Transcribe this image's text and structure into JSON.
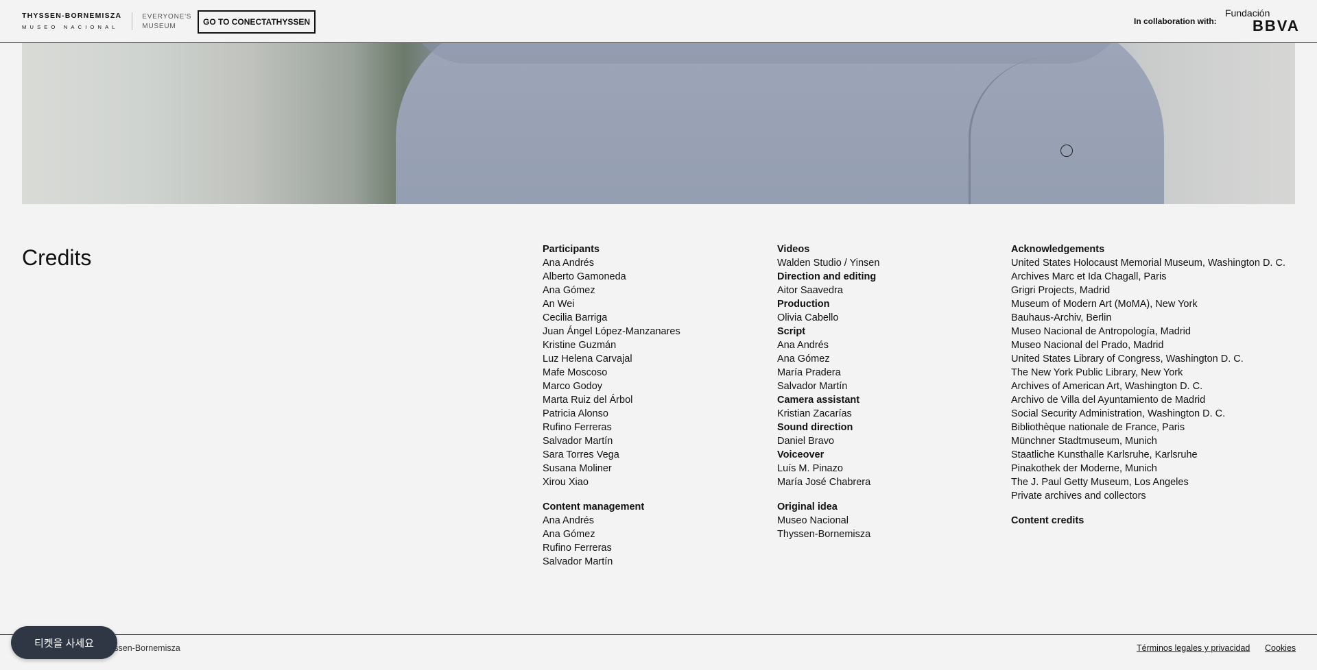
{
  "header": {
    "logo_main": "THYSSEN-BORNEMISZA",
    "logo_sub": "MUSEO NACIONAL",
    "logo_tag_line1": "EVERYONE'S",
    "logo_tag_line2": "MUSEUM",
    "conecta_button": "GO TO CONECTATHYSSEN",
    "collab_label": "In collaboration with:",
    "sponsor_line1": "Fundación",
    "sponsor_line2": "BBVA"
  },
  "credits": {
    "title": "Credits",
    "col1": [
      {
        "type": "h",
        "text": "Participants"
      },
      {
        "type": "t",
        "text": "Ana Andrés"
      },
      {
        "type": "t",
        "text": "Alberto Gamoneda"
      },
      {
        "type": "t",
        "text": "Ana Gómez"
      },
      {
        "type": "t",
        "text": "An Wei"
      },
      {
        "type": "t",
        "text": "Cecilia Barriga"
      },
      {
        "type": "t",
        "text": "Juan Ángel López-Manzanares"
      },
      {
        "type": "t",
        "text": "Kristine Guzmán"
      },
      {
        "type": "t",
        "text": "Luz Helena Carvajal"
      },
      {
        "type": "t",
        "text": "Mafe Moscoso"
      },
      {
        "type": "t",
        "text": "Marco Godoy"
      },
      {
        "type": "t",
        "text": "Marta Ruiz del Árbol"
      },
      {
        "type": "t",
        "text": "Patricia Alonso"
      },
      {
        "type": "t",
        "text": "Rufino Ferreras"
      },
      {
        "type": "t",
        "text": "Salvador Martín"
      },
      {
        "type": "t",
        "text": "Sara Torres Vega"
      },
      {
        "type": "t",
        "text": "Susana Moliner"
      },
      {
        "type": "t",
        "text": "Xirou Xiao"
      },
      {
        "type": "gap",
        "text": ""
      },
      {
        "type": "h",
        "text": "Content management"
      },
      {
        "type": "t",
        "text": "Ana Andrés"
      },
      {
        "type": "t",
        "text": "Ana Gómez"
      },
      {
        "type": "t",
        "text": "Rufino Ferreras"
      },
      {
        "type": "t",
        "text": "Salvador Martín"
      }
    ],
    "col2": [
      {
        "type": "h",
        "text": "Videos"
      },
      {
        "type": "t",
        "text": "Walden Studio / Yinsen"
      },
      {
        "type": "h",
        "text": "Direction and editing"
      },
      {
        "type": "t",
        "text": "Aitor Saavedra"
      },
      {
        "type": "h",
        "text": "Production"
      },
      {
        "type": "t",
        "text": "Olivia Cabello"
      },
      {
        "type": "h",
        "text": "Script"
      },
      {
        "type": "t",
        "text": "Ana Andrés"
      },
      {
        "type": "t",
        "text": "Ana Gómez"
      },
      {
        "type": "t",
        "text": "María Pradera"
      },
      {
        "type": "t",
        "text": "Salvador Martín"
      },
      {
        "type": "h",
        "text": "Camera assistant"
      },
      {
        "type": "t",
        "text": "Kristian Zacarías"
      },
      {
        "type": "h",
        "text": "Sound direction"
      },
      {
        "type": "t",
        "text": "Daniel Bravo"
      },
      {
        "type": "h",
        "text": "Voiceover"
      },
      {
        "type": "t",
        "text": "Luís M. Pinazo"
      },
      {
        "type": "t",
        "text": "María José Chabrera"
      },
      {
        "type": "gap",
        "text": ""
      },
      {
        "type": "h",
        "text": "Original idea"
      },
      {
        "type": "t",
        "text": "Museo Nacional"
      },
      {
        "type": "t",
        "text": "Thyssen-Bornemisza"
      }
    ],
    "col3": [
      {
        "type": "h",
        "text": "Acknowledgements"
      },
      {
        "type": "t",
        "text": "United States Holocaust Memorial Museum, Washington D. C."
      },
      {
        "type": "t",
        "text": "Archives Marc et Ida Chagall, Paris"
      },
      {
        "type": "t",
        "text": "Grigri Projects, Madrid"
      },
      {
        "type": "t",
        "text": "Museum of Modern Art (MoMA), New York"
      },
      {
        "type": "t",
        "text": "Bauhaus-Archiv, Berlin"
      },
      {
        "type": "t",
        "text": "Museo Nacional de Antropología, Madrid"
      },
      {
        "type": "t",
        "text": "Museo Nacional del Prado, Madrid"
      },
      {
        "type": "t",
        "text": "United States Library of Congress, Washington D. C."
      },
      {
        "type": "t",
        "text": "The New York Public Library, New York"
      },
      {
        "type": "t",
        "text": "Archives of American Art, Washington D. C."
      },
      {
        "type": "t",
        "text": "Archivo de Villa del Ayuntamiento de Madrid"
      },
      {
        "type": "t",
        "text": "Social Security Administration, Washington D. C."
      },
      {
        "type": "t",
        "text": "Bibliothèque nationale de France, Paris"
      },
      {
        "type": "t",
        "text": "Münchner Stadtmuseum, Munich"
      },
      {
        "type": "t",
        "text": "Staatliche Kunsthalle Karlsruhe, Karlsruhe"
      },
      {
        "type": "t",
        "text": "Pinakothek der Moderne, Munich"
      },
      {
        "type": "t",
        "text": "The J. Paul Getty Museum, Los Angeles"
      },
      {
        "type": "t",
        "text": "Private archives and collectors"
      },
      {
        "type": "gap",
        "text": ""
      },
      {
        "type": "h",
        "text": "Content credits"
      }
    ]
  },
  "footer": {
    "copyright": "yssen-Bornemisza",
    "legal_link": "Términos legales y privacidad",
    "cookies_link": "Cookies"
  },
  "ticket_button": "티켓을 사세요"
}
